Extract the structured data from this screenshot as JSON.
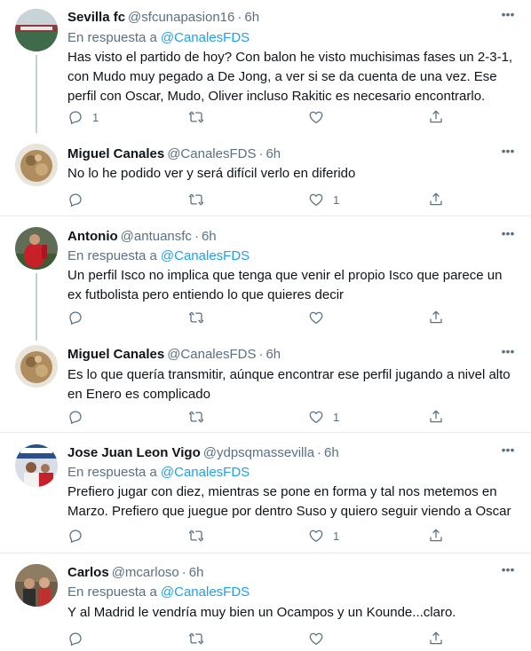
{
  "reply_prefix": "En respuesta a",
  "more_label": "•••",
  "tweets": [
    {
      "name": "Sevilla fc",
      "handle": "@sfcunapasion16",
      "time": "6h",
      "reply_to": "@CanalesFDS",
      "text": "Has visto el partido de hoy? Con balon he visto muchisimas fases un 2-3-1, con Mudo muy pegado a De Jong, a ver si se da cuenta de una vez. Ese perfil con Oscar, Mudo, Oliver incluso Rakitic es necesario encontrarlo.",
      "reply_count": "1",
      "retweet_count": "",
      "like_count": ""
    },
    {
      "name": "Miguel Canales",
      "handle": "@CanalesFDS",
      "time": "6h",
      "reply_to": "",
      "text": "No lo he podido ver y será difícil verlo en diferido",
      "reply_count": "",
      "retweet_count": "",
      "like_count": "1"
    },
    {
      "name": "Antonio",
      "handle": "@antuansfc",
      "time": "6h",
      "reply_to": "@CanalesFDS",
      "text": "Un perfil Isco no implica que tenga que venir el propio Isco que parece un ex futbolista pero entiendo lo que quieres decir",
      "reply_count": "",
      "retweet_count": "",
      "like_count": ""
    },
    {
      "name": "Miguel Canales",
      "handle": "@CanalesFDS",
      "time": "6h",
      "reply_to": "",
      "text": "Es lo que quería transmitir, aúnque encontrar ese perfil jugando a nivel alto en Enero es complicado",
      "reply_count": "",
      "retweet_count": "",
      "like_count": "1"
    },
    {
      "name": "Jose Juan Leon Vigo",
      "handle": "@ydpsqmassevilla",
      "time": "6h",
      "reply_to": "@CanalesFDS",
      "text": "Prefiero jugar con diez, mientras se pone en forma y tal nos metemos en Marzo. Prefiero que juegue por dentro Suso y quiero seguir viendo a Oscar",
      "reply_count": "",
      "retweet_count": "",
      "like_count": "1"
    },
    {
      "name": "Carlos",
      "handle": "@mcarloso",
      "time": "6h",
      "reply_to": "@CanalesFDS",
      "text": "Y al Madrid le vendría muy bien un Ocampos y un Kounde...claro.",
      "reply_count": "",
      "retweet_count": "",
      "like_count": ""
    }
  ],
  "icons": {
    "reply": "reply-icon",
    "retweet": "retweet-icon",
    "like": "heart-icon",
    "share": "share-icon",
    "more": "more-icon"
  },
  "colors": {
    "link": "#1da1f2",
    "muted": "#5b7083",
    "text": "#0f1419",
    "separator": "#e6ecf0"
  }
}
